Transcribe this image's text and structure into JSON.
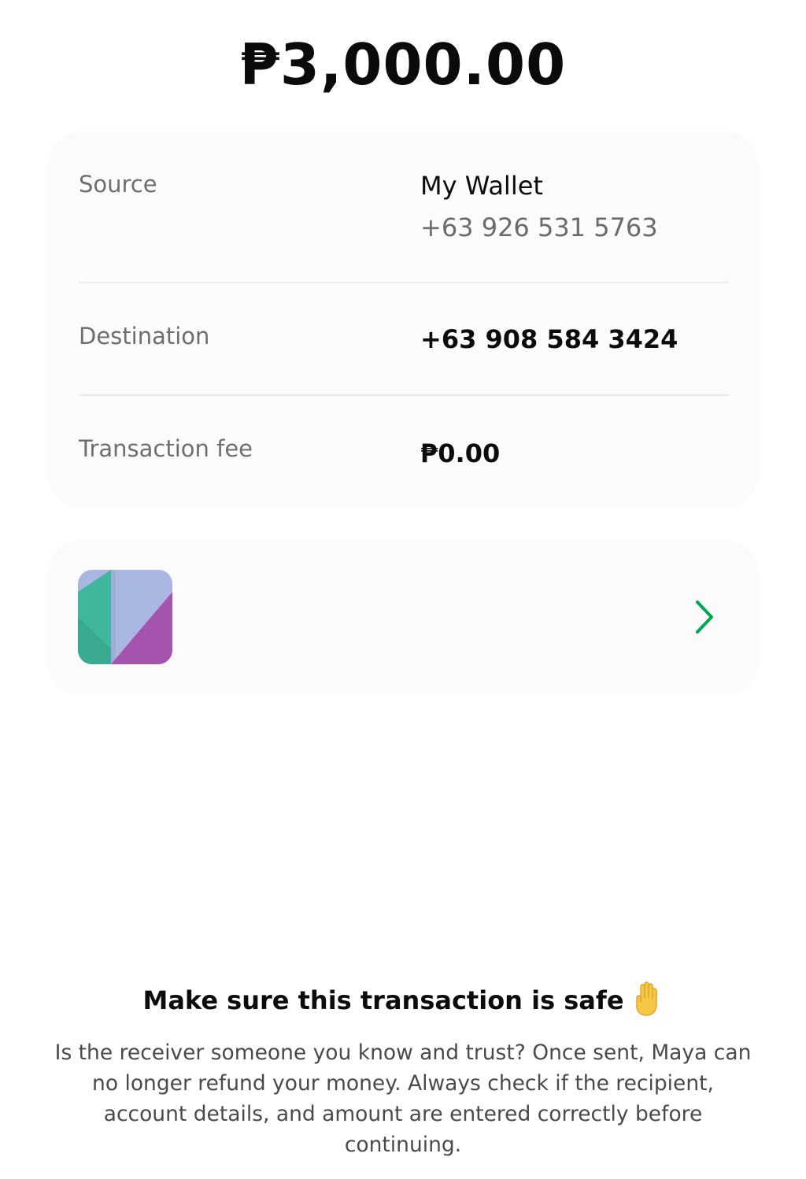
{
  "amount": "₱3,000.00",
  "details": {
    "source_label": "Source",
    "source_name": "My Wallet",
    "source_number": "+63 926 531 5763",
    "destination_label": "Destination",
    "destination_number": "+63 908 584 3424",
    "fee_label": "Transaction fee",
    "fee_value": "₱0.00"
  },
  "promo": {
    "logo_icon": "maya-app-logo-icon",
    "chevron_icon": "chevron-right-icon",
    "accent_color": "#00a651"
  },
  "warning": {
    "title": "Make sure this transaction is safe",
    "icon": "raised-hand-icon",
    "body": "Is the receiver someone you know and trust? Once sent, Maya can no longer refund your money. Always check if the recipient, account details, and amount are entered correctly before continuing."
  }
}
